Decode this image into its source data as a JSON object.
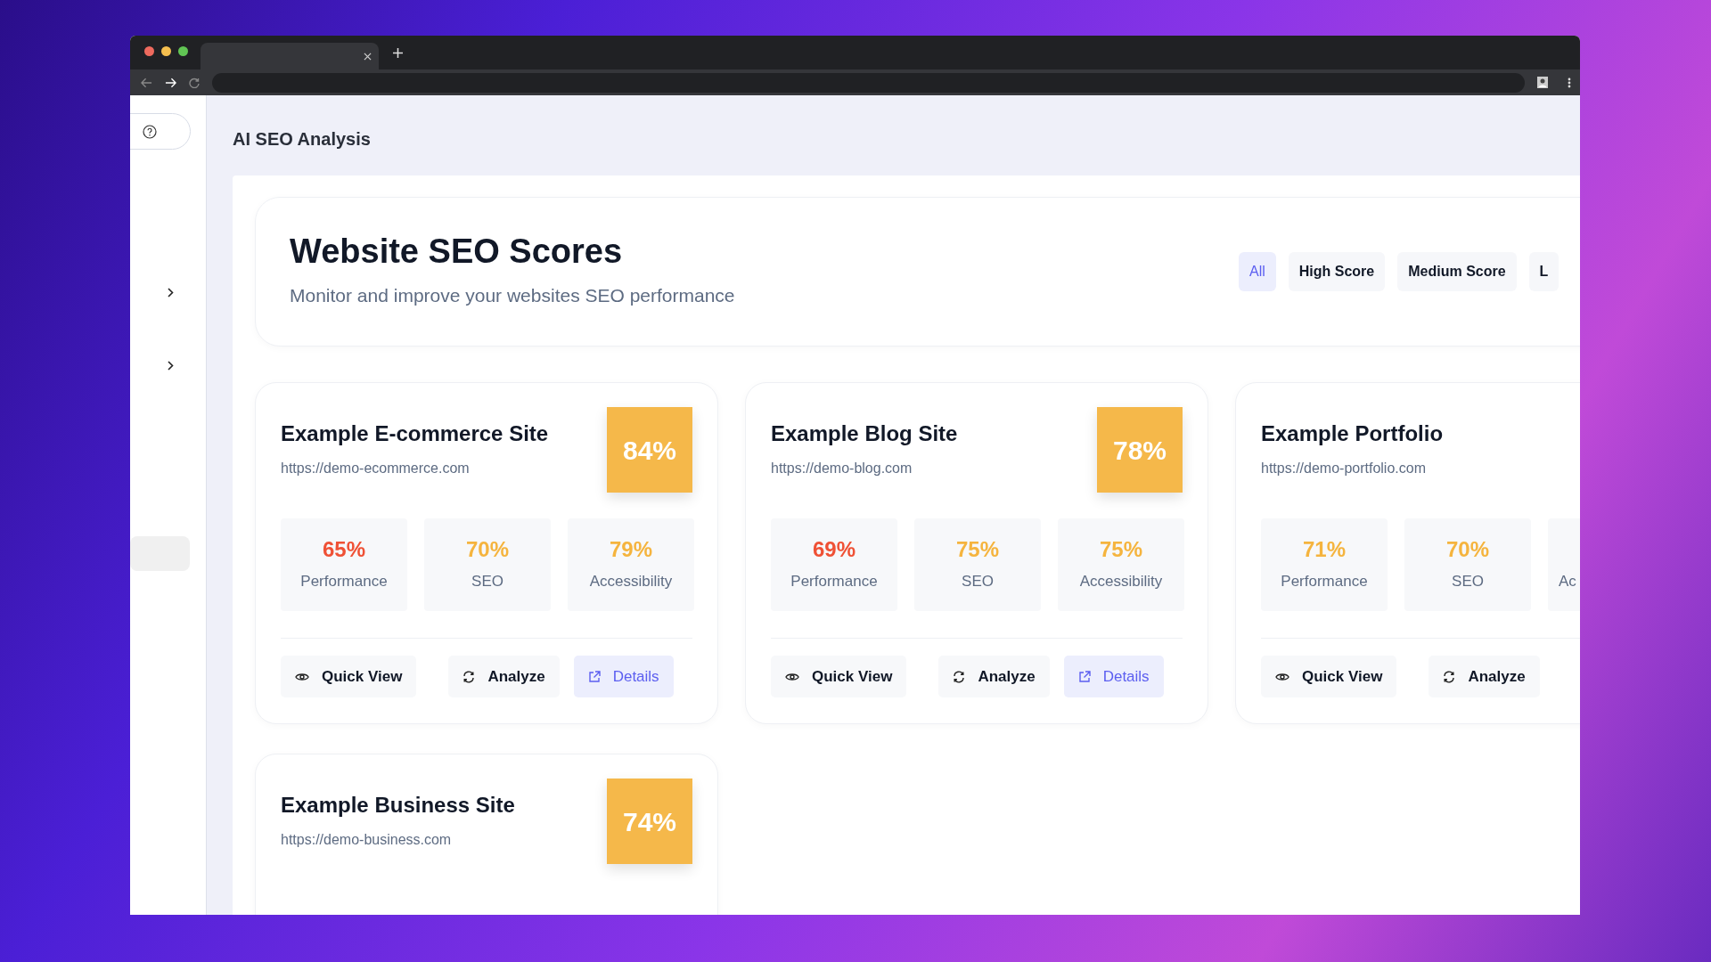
{
  "sidebar": {
    "items": [
      {
        "kind": "expandable",
        "selected": false
      },
      {
        "kind": "expandable",
        "selected": false
      },
      {
        "kind": "plain",
        "selected": true
      }
    ]
  },
  "page_title": "AI SEO Analysis",
  "header": {
    "title": "Website SEO Scores",
    "subtitle": "Monitor and improve your websites SEO performance"
  },
  "filters": [
    {
      "label": "All",
      "selected": true
    },
    {
      "label": "High Score",
      "selected": false
    },
    {
      "label": "Medium Score",
      "selected": false
    },
    {
      "label": "L",
      "selected": false
    }
  ],
  "sites": [
    {
      "name": "Example E-commerce Site",
      "url": "https://demo-ecommerce.com",
      "score": "84%",
      "metrics": [
        {
          "value": "65%",
          "label": "Performance",
          "color": "#ef5135"
        },
        {
          "value": "70%",
          "label": "SEO",
          "color": "#f5b43e"
        },
        {
          "value": "79%",
          "label": "Accessibility",
          "color": "#f5b43e"
        }
      ],
      "actions": [
        {
          "kind": "quick_view",
          "label": "Quick View"
        },
        {
          "kind": "analyze",
          "label": "Analyze"
        },
        {
          "kind": "details",
          "label": "Details"
        }
      ]
    },
    {
      "name": "Example Blog Site",
      "url": "https://demo-blog.com",
      "score": "78%",
      "metrics": [
        {
          "value": "69%",
          "label": "Performance",
          "color": "#ef5135"
        },
        {
          "value": "75%",
          "label": "SEO",
          "color": "#f5b43e"
        },
        {
          "value": "75%",
          "label": "Accessibility",
          "color": "#f5b43e"
        }
      ],
      "actions": [
        {
          "kind": "quick_view",
          "label": "Quick View"
        },
        {
          "kind": "analyze",
          "label": "Analyze"
        },
        {
          "kind": "details",
          "label": "Details"
        }
      ]
    },
    {
      "name": "Example Portfolio",
      "url": "https://demo-portfolio.com",
      "metrics": [
        {
          "value": "71%",
          "label": "Performance",
          "color": "#f5b43e"
        },
        {
          "value": "70%",
          "label": "SEO",
          "color": "#f5b43e"
        },
        {
          "label": "Ac"
        }
      ],
      "actions": [
        {
          "kind": "quick_view",
          "label": "Quick View"
        },
        {
          "kind": "analyze",
          "label": "Analyze"
        }
      ]
    },
    {
      "name": "Example Business Site",
      "url": "https://demo-business.com",
      "score": "74%"
    }
  ]
}
